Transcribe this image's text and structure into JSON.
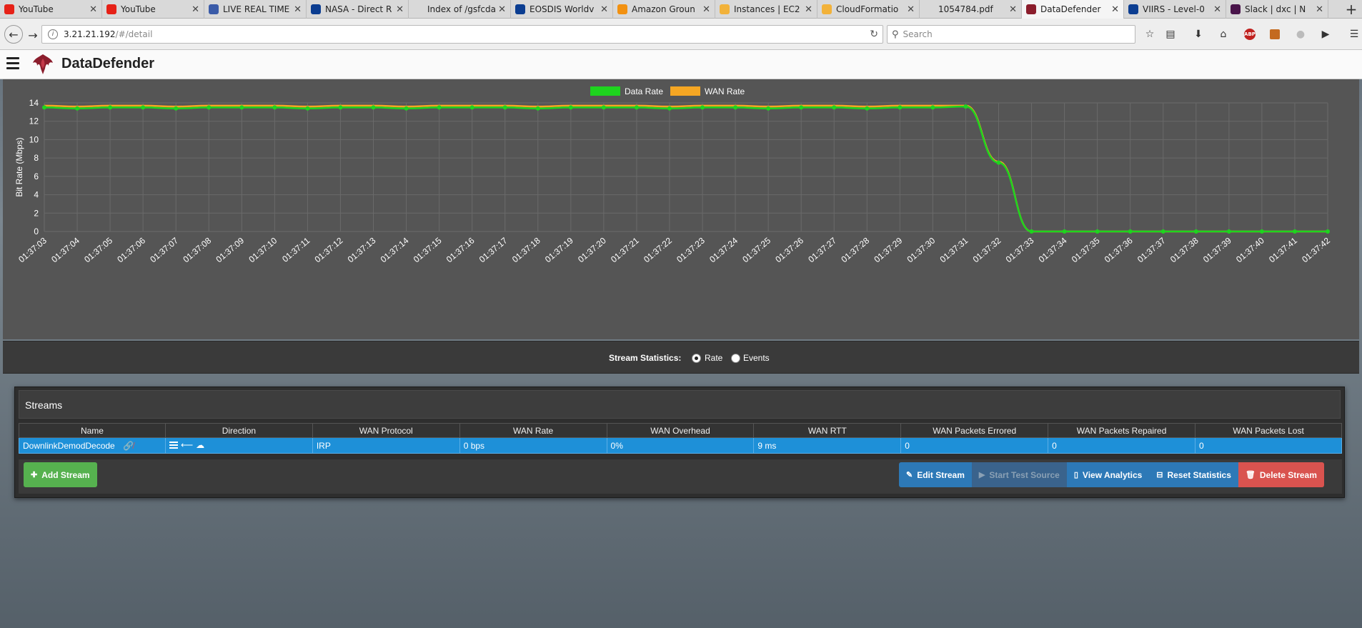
{
  "browser": {
    "tabs": [
      {
        "title": "YouTube",
        "icon": "youtube-icon",
        "color": "#e62117",
        "active": false
      },
      {
        "title": "YouTube",
        "icon": "youtube-icon",
        "color": "#e62117",
        "active": false
      },
      {
        "title": "LIVE REAL TIME",
        "icon": "live-icon",
        "color": "#3a5ba8",
        "active": false
      },
      {
        "title": "NASA - Direct R",
        "icon": "nasa-icon",
        "color": "#0b3d91",
        "active": false
      },
      {
        "title": "Index of /gsfcdata/",
        "icon": "",
        "color": "",
        "active": false
      },
      {
        "title": "EOSDIS Worldv",
        "icon": "nasa-icon",
        "color": "#0b3d91",
        "active": false
      },
      {
        "title": "Amazon Groun",
        "icon": "aws-icon",
        "color": "#f29111",
        "active": false
      },
      {
        "title": "Instances | EC2",
        "icon": "aws-icon",
        "color": "#f2b23a",
        "active": false
      },
      {
        "title": "CloudFormatio",
        "icon": "aws-icon",
        "color": "#f2b23a",
        "active": false
      },
      {
        "title": "1054784.pdf",
        "icon": "",
        "color": "",
        "active": false
      },
      {
        "title": "DataDefender",
        "icon": "datadefender-icon",
        "color": "#8b1d2c",
        "active": true
      },
      {
        "title": "VIIRS - Level-0",
        "icon": "nasa-icon",
        "color": "#0b3d91",
        "active": false
      },
      {
        "title": "Slack | dxc | N",
        "icon": "slack-icon",
        "color": "#4a154b",
        "active": false
      }
    ],
    "url_host": "3.21.21.192",
    "url_path": "/#/detail",
    "search_placeholder": "Search"
  },
  "app": {
    "brand": "DataDefender"
  },
  "chart_data": {
    "type": "line",
    "title": "",
    "xlabel": "",
    "ylabel": "Bit Rate (Mbps)",
    "ylim": [
      0,
      14
    ],
    "yticks": [
      0,
      2,
      4,
      6,
      8,
      10,
      12,
      14
    ],
    "legend": "top-center",
    "grid": true,
    "x": [
      "01:37:03",
      "01:37:04",
      "01:37:05",
      "01:37:06",
      "01:37:07",
      "01:37:08",
      "01:37:09",
      "01:37:10",
      "01:37:11",
      "01:37:12",
      "01:37:13",
      "01:37:14",
      "01:37:15",
      "01:37:16",
      "01:37:17",
      "01:37:18",
      "01:37:19",
      "01:37:20",
      "01:37:21",
      "01:37:22",
      "01:37:23",
      "01:37:24",
      "01:37:25",
      "01:37:26",
      "01:37:27",
      "01:37:28",
      "01:37:29",
      "01:37:30",
      "01:37:31",
      "01:37:32",
      "01:37:33",
      "01:37:34",
      "01:37:35",
      "01:37:36",
      "01:37:37",
      "01:37:38",
      "01:37:39",
      "01:37:40",
      "01:37:41",
      "01:37:42"
    ],
    "series": [
      {
        "name": "Data Rate",
        "color": "#1ed41e",
        "values": [
          13.5,
          13.4,
          13.5,
          13.5,
          13.4,
          13.5,
          13.5,
          13.5,
          13.4,
          13.5,
          13.5,
          13.4,
          13.5,
          13.5,
          13.5,
          13.4,
          13.5,
          13.5,
          13.5,
          13.4,
          13.5,
          13.5,
          13.4,
          13.5,
          13.5,
          13.4,
          13.5,
          13.5,
          13.6,
          7.5,
          0,
          0,
          0,
          0,
          0,
          0,
          0,
          0,
          0,
          0
        ]
      },
      {
        "name": "WAN Rate",
        "color": "#f5a623",
        "values": [
          13.7,
          13.6,
          13.7,
          13.7,
          13.6,
          13.7,
          13.7,
          13.7,
          13.6,
          13.7,
          13.7,
          13.6,
          13.7,
          13.7,
          13.7,
          13.6,
          13.7,
          13.7,
          13.7,
          13.6,
          13.7,
          13.7,
          13.6,
          13.7,
          13.7,
          13.6,
          13.7,
          13.7,
          13.7,
          7.6,
          0,
          0,
          0,
          0,
          0,
          0,
          0,
          0,
          0,
          0
        ]
      }
    ]
  },
  "stats": {
    "label": "Stream Statistics:",
    "options": [
      {
        "label": "Rate",
        "checked": true
      },
      {
        "label": "Events",
        "checked": false
      }
    ]
  },
  "streams": {
    "title": "Streams",
    "columns": [
      "Name",
      "Direction",
      "WAN Protocol",
      "WAN Rate",
      "WAN Overhead",
      "WAN RTT",
      "WAN Packets Errored",
      "WAN Packets Repaired",
      "WAN Packets Lost"
    ],
    "rows": [
      {
        "name": "DownlinkDemodDecode",
        "direction": "",
        "protocol": "IRP",
        "rate": "0 bps",
        "overhead": "0%",
        "rtt": "9 ms",
        "errored": "0",
        "repaired": "0",
        "lost": "0"
      }
    ]
  },
  "buttons": {
    "add": "Add Stream",
    "edit": "Edit Stream",
    "test": "Start Test Source",
    "analytics": "View Analytics",
    "reset": "Reset Statistics",
    "delete": "Delete Stream"
  }
}
